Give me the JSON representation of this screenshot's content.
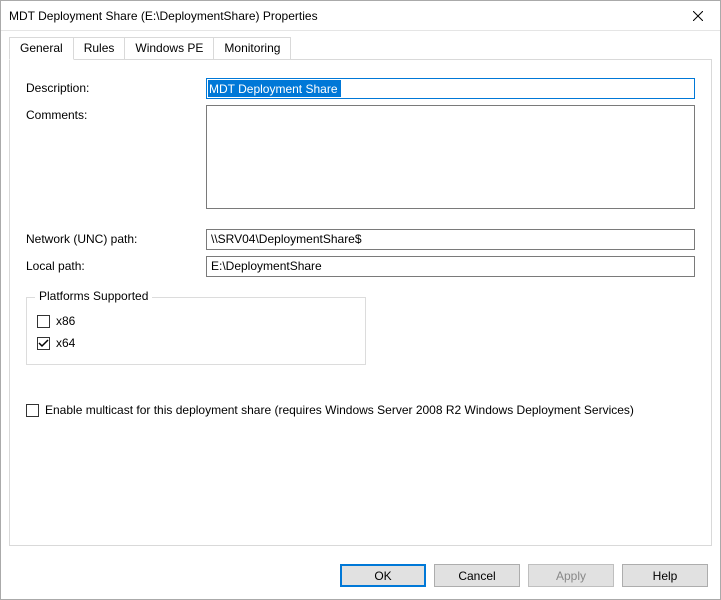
{
  "window": {
    "title": "MDT Deployment Share (E:\\DeploymentShare) Properties"
  },
  "tabs": {
    "general": "General",
    "rules": "Rules",
    "windows_pe": "Windows PE",
    "monitoring": "Monitoring"
  },
  "general": {
    "description_label": "Description:",
    "description_value": "MDT Deployment Share",
    "comments_label": "Comments:",
    "comments_value": "",
    "unc_label": "Network (UNC) path:",
    "unc_value": "\\\\SRV04\\DeploymentShare$",
    "local_label": "Local path:",
    "local_value": "E:\\DeploymentShare",
    "platforms_legend": "Platforms Supported",
    "x86_label": "x86",
    "x86_checked": false,
    "x64_label": "x64",
    "x64_checked": true,
    "multicast_label": "Enable multicast for this deployment share (requires Windows Server 2008 R2 Windows Deployment Services)",
    "multicast_checked": false
  },
  "buttons": {
    "ok": "OK",
    "cancel": "Cancel",
    "apply": "Apply",
    "help": "Help"
  }
}
